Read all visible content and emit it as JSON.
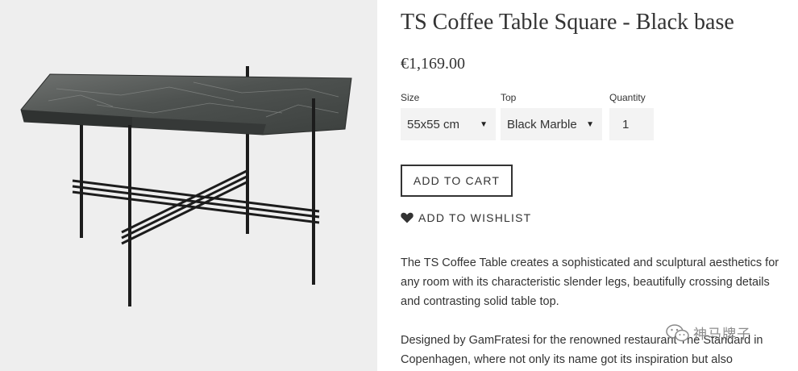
{
  "product": {
    "title": "TS Coffee Table Square - Black base",
    "price": "€1,169.00",
    "image_alt": "TS Coffee Table with black marble top and black base"
  },
  "options": {
    "size": {
      "label": "Size",
      "value": "55x55 cm"
    },
    "top": {
      "label": "Top",
      "value": "Black Marble"
    },
    "quantity": {
      "label": "Quantity",
      "value": "1"
    }
  },
  "actions": {
    "add_to_cart": "ADD TO CART",
    "wishlist": "ADD TO WISHLIST"
  },
  "description": {
    "paragraph1": "The TS Coffee Table creates a sophisticated and sculptural aesthetics for any room with its characteristic slender legs, beautifully crossing details and contrasting solid table top.",
    "paragraph2": "Designed by GamFratesi for the renowned restaurant The Standard in Copenhagen, where not only its name got its inspiration but also"
  },
  "watermark": {
    "text": "神马牌子"
  },
  "icons": {
    "caret": "caret-down-icon",
    "wishlist": "heart-icon",
    "watermark": "wechat-icon"
  },
  "colors": {
    "image_background": "#eeeeee",
    "select_background": "#f3f3f3",
    "text": "#333333"
  }
}
